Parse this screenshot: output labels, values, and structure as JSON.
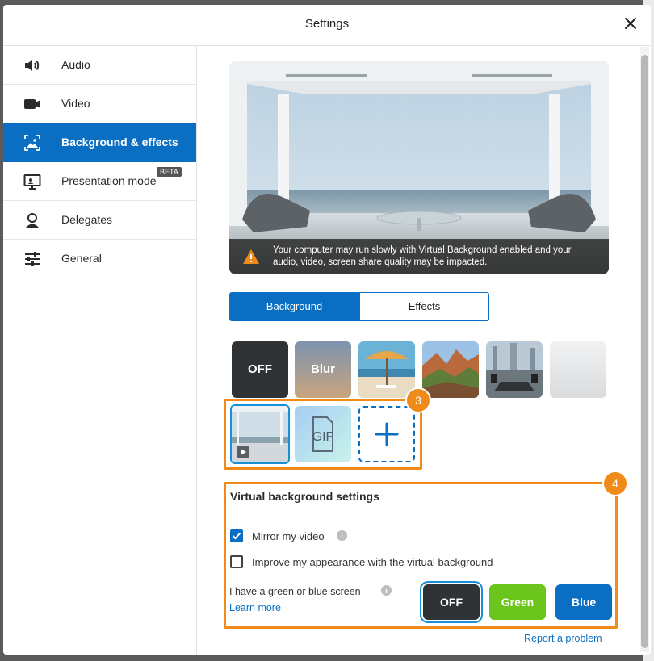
{
  "dialog": {
    "title": "Settings",
    "close_icon": "close-icon"
  },
  "sidebar": {
    "items": [
      {
        "label": "Audio",
        "icon": "speaker-icon",
        "active": false
      },
      {
        "label": "Video",
        "icon": "video-camera-icon",
        "active": false
      },
      {
        "label": "Background & effects",
        "icon": "background-image-icon",
        "active": true
      },
      {
        "label": "Presentation mode",
        "icon": "presentation-monitor-icon",
        "active": false,
        "badge": "BETA"
      },
      {
        "label": "Delegates",
        "icon": "delegate-user-icon",
        "active": false
      },
      {
        "label": "General",
        "icon": "sliders-icon",
        "active": false
      }
    ]
  },
  "preview": {
    "warning": "Your computer may run slowly with Virtual Background enabled and your audio, video, screen share quality may be impacted."
  },
  "tabs": [
    {
      "label": "Background",
      "active": true
    },
    {
      "label": "Effects",
      "active": false
    }
  ],
  "backgrounds": {
    "row1": [
      {
        "label": "OFF",
        "kind": "off"
      },
      {
        "label": "Blur",
        "kind": "blur"
      },
      {
        "label": "",
        "kind": "beach-umbrella"
      },
      {
        "label": "",
        "kind": "canyon"
      },
      {
        "label": "",
        "kind": "boardroom"
      },
      {
        "label": "",
        "kind": "white-studio"
      }
    ],
    "row2": [
      {
        "label": "",
        "kind": "video-lounge",
        "selected": true
      },
      {
        "label": "GIF",
        "kind": "gif"
      },
      {
        "label": "",
        "kind": "add"
      }
    ],
    "callout_3": "3",
    "callout_4": "4"
  },
  "virtual_settings": {
    "title": "Virtual background settings",
    "mirror_label": "Mirror my video",
    "mirror_checked": true,
    "appearance_label": "Improve my appearance with the virtual background",
    "appearance_checked": false,
    "screen_label": "I have a green or blue screen",
    "learn_more": "Learn more",
    "screen_buttons": [
      {
        "label": "OFF",
        "color": "#2f3336",
        "selected": true
      },
      {
        "label": "Green",
        "color": "#6cc51c",
        "selected": false
      },
      {
        "label": "Blue",
        "color": "#0a6fc2",
        "selected": false
      }
    ]
  },
  "footer": {
    "report": "Report a problem"
  },
  "colors": {
    "accent": "#0a6fc2",
    "callout": "#f08a18"
  }
}
